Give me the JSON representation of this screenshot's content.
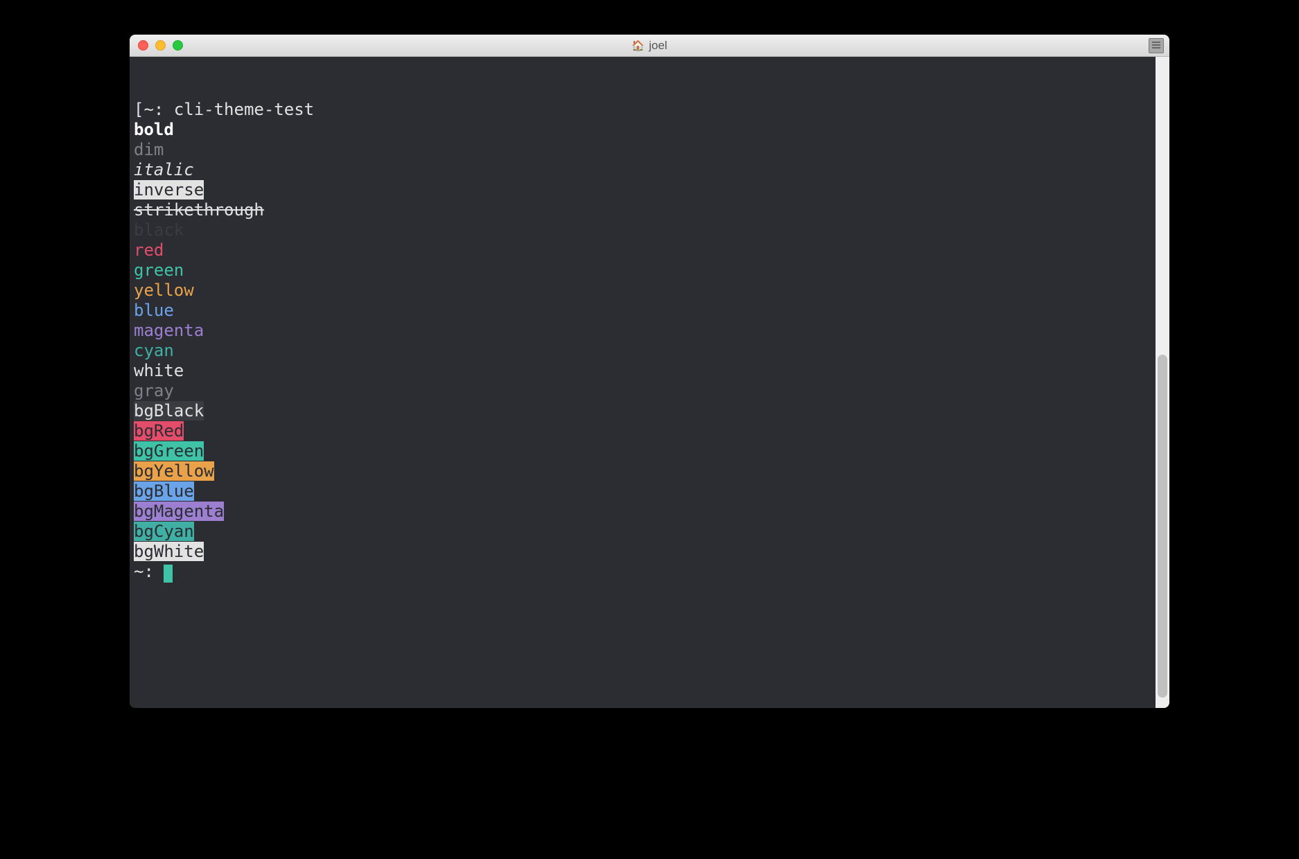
{
  "window": {
    "title": "joel",
    "home_icon": "🏠"
  },
  "terminal": {
    "prompt_line": "[~: cli-theme-test",
    "prompt_end": "~: ",
    "lines": [
      {
        "text": "bold",
        "class": "bold"
      },
      {
        "text": "dim",
        "class": "dim"
      },
      {
        "text": "italic",
        "class": "italic"
      },
      {
        "text": "inverse",
        "class": "inverse"
      },
      {
        "text": "strikethrough",
        "class": "strike"
      },
      {
        "text": "black",
        "class": "fg-black"
      },
      {
        "text": "red",
        "class": "fg-red"
      },
      {
        "text": "green",
        "class": "fg-green"
      },
      {
        "text": "yellow",
        "class": "fg-yellow"
      },
      {
        "text": "blue",
        "class": "fg-blue"
      },
      {
        "text": "magenta",
        "class": "fg-magenta"
      },
      {
        "text": "cyan",
        "class": "fg-cyan"
      },
      {
        "text": "white",
        "class": "fg-white"
      },
      {
        "text": "gray",
        "class": "fg-gray"
      },
      {
        "text": "bgBlack",
        "class": "bg-black"
      },
      {
        "text": "bgRed",
        "class": "bg-red"
      },
      {
        "text": "bgGreen",
        "class": "bg-green"
      },
      {
        "text": "bgYellow",
        "class": "bg-yellow"
      },
      {
        "text": "bgBlue",
        "class": "bg-blue"
      },
      {
        "text": "bgMagenta",
        "class": "bg-magenta"
      },
      {
        "text": "bgCyan",
        "class": "bg-cyan"
      },
      {
        "text": "bgWhite",
        "class": "bg-white"
      }
    ]
  },
  "colors": {
    "background": "#2b2d33",
    "foreground": "#e2e2e2",
    "black": "#3a3c42",
    "red": "#e44d6a",
    "green": "#3fc3a7",
    "yellow": "#e9a24a",
    "blue": "#6aa3e8",
    "magenta": "#9d7fd1",
    "cyan": "#3fb0a3",
    "white": "#e2e2e2",
    "gray": "#7e8187"
  }
}
